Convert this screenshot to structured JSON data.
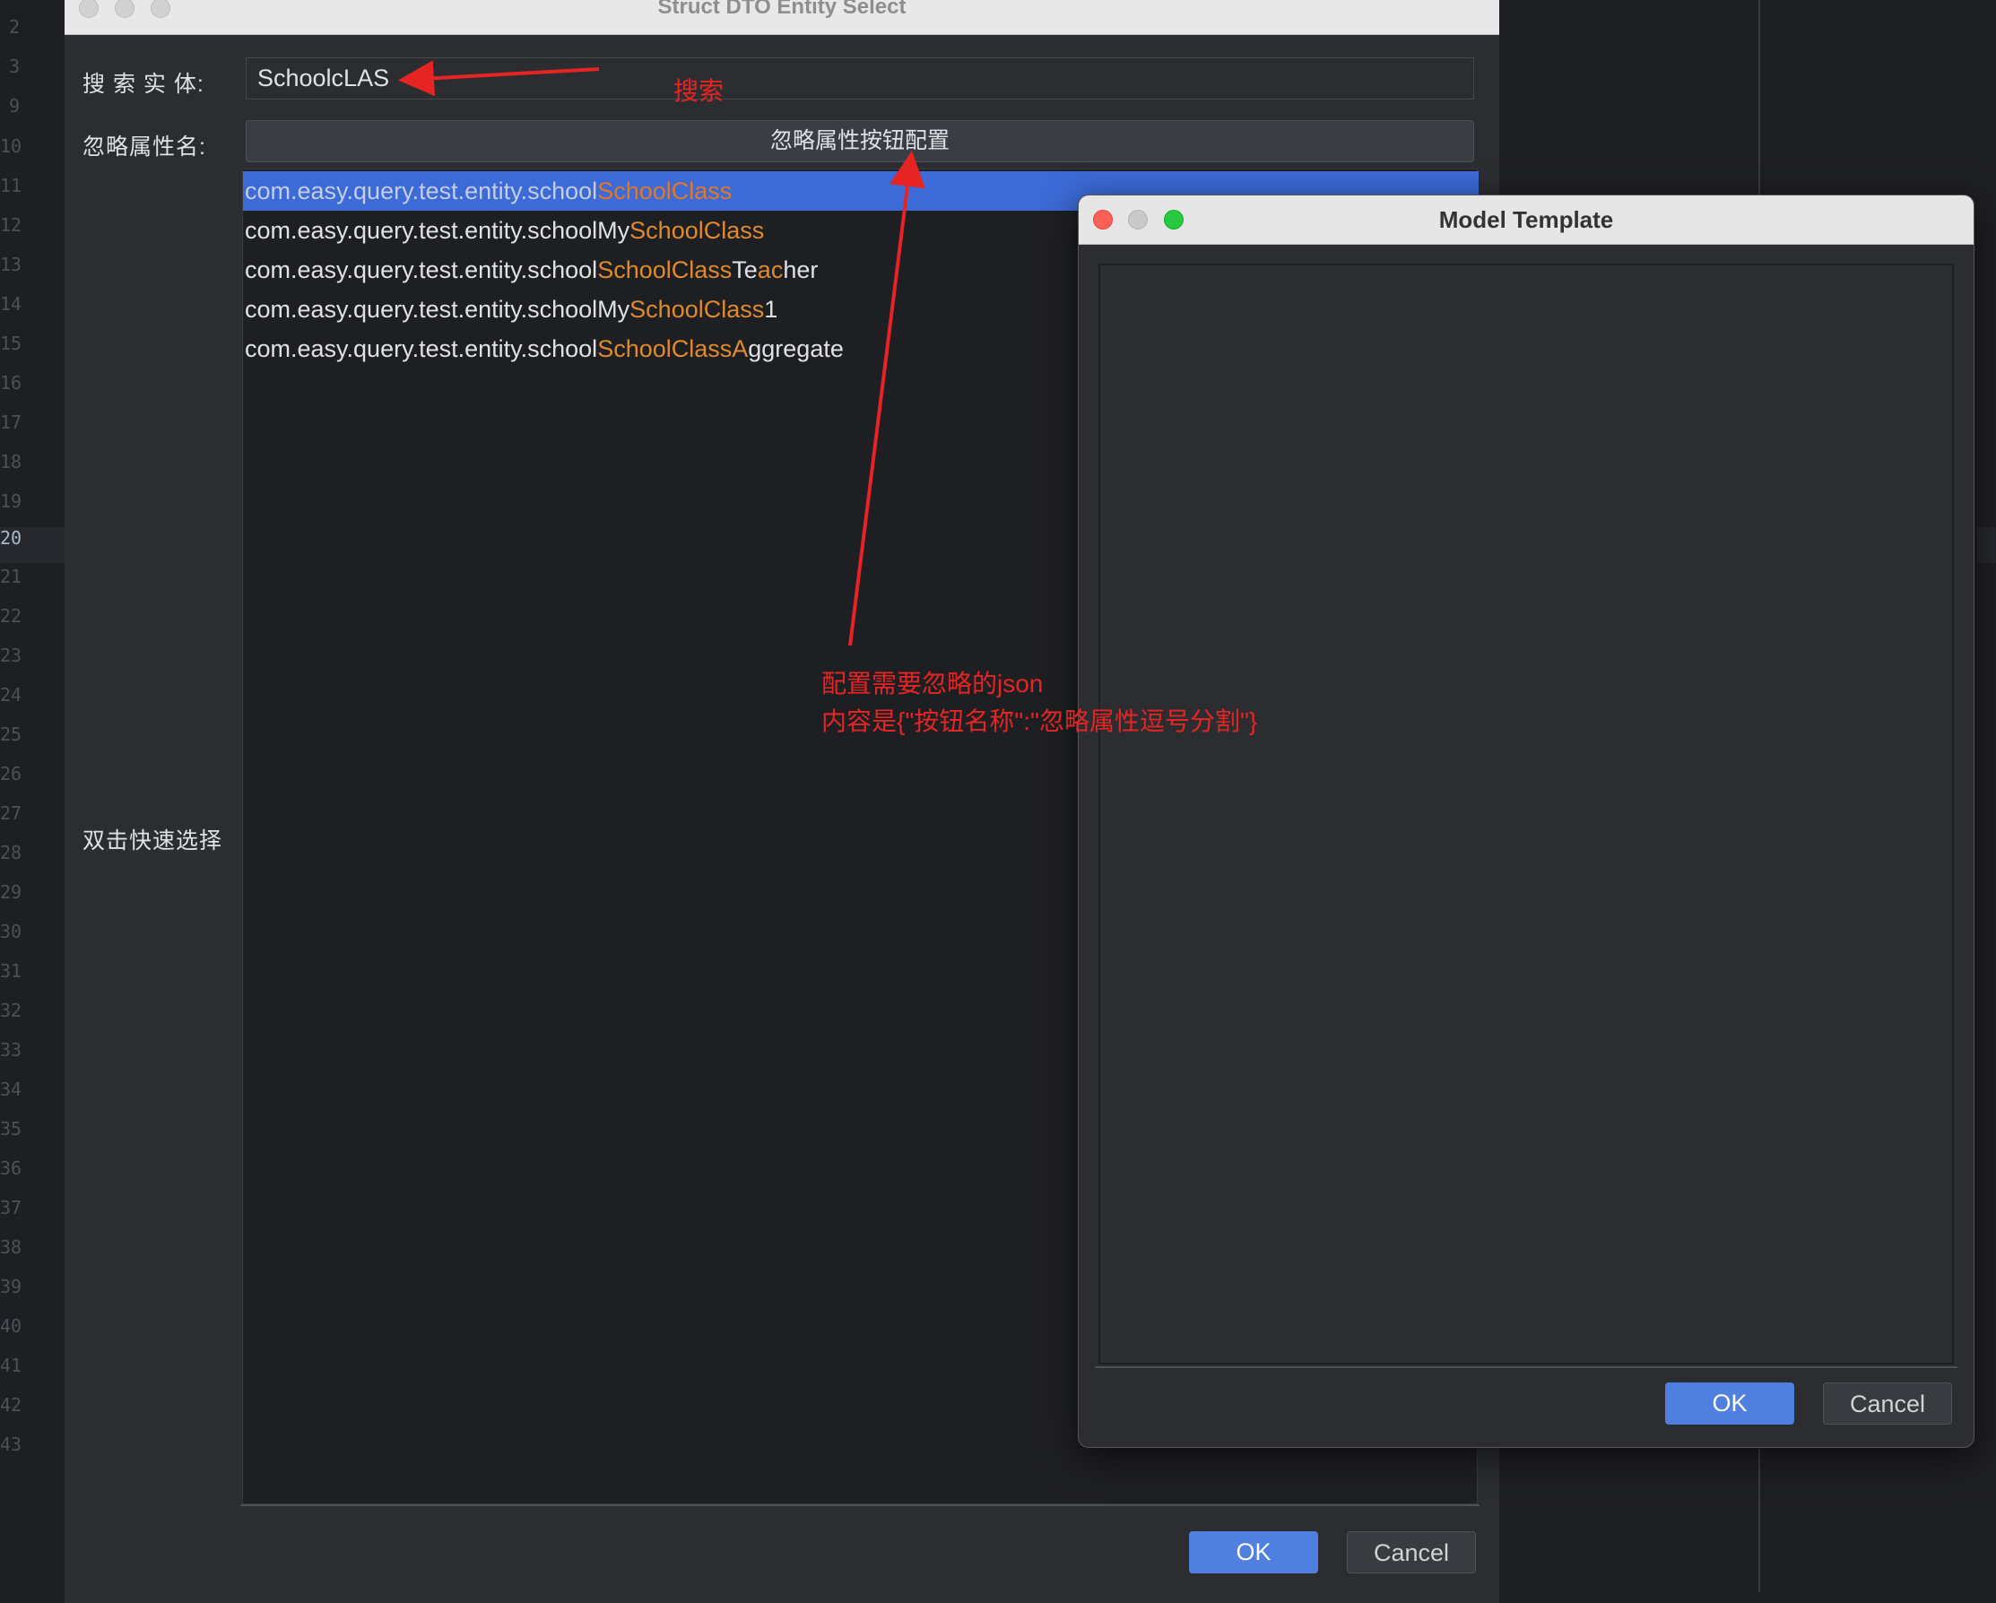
{
  "editor": {
    "line_numbers": [
      "2",
      "3",
      "9",
      "10",
      "11",
      "12",
      "13",
      "14",
      "15",
      "16",
      "17",
      "18",
      "19",
      "20",
      "21",
      "22",
      "23",
      "24",
      "25",
      "26",
      "27",
      "28",
      "29",
      "30",
      "31",
      "32",
      "33",
      "34",
      "35",
      "36",
      "37",
      "38",
      "39",
      "40",
      "41",
      "42",
      "43"
    ]
  },
  "main_dialog": {
    "title": "Struct DTO Entity Select",
    "search_label": "搜 索 实 体:",
    "search_value": "SchoolcLAS",
    "ignore_label": "忽略属性名:",
    "ignore_button": "忽略属性按钮配置",
    "list_label": "双击快速选择",
    "entities": [
      {
        "prefix": "com.easy.query.test.entity.school",
        "parts": [
          {
            "t": "SchoolClass",
            "h": true
          }
        ],
        "selected": true
      },
      {
        "prefix": "com.easy.query.test.entity.schoolMy",
        "parts": [
          {
            "t": "SchoolClass",
            "h": true
          }
        ],
        "selected": false
      },
      {
        "prefix": "com.easy.query.test.entity.school",
        "parts": [
          {
            "t": "SchoolClass",
            "h": true
          },
          {
            "t": "Te",
            "h": false
          },
          {
            "t": "ac",
            "h": true
          },
          {
            "t": "her",
            "h": false
          }
        ],
        "selected": false
      },
      {
        "prefix": "com.easy.query.test.entity.schoolMy",
        "parts": [
          {
            "t": "SchoolClass",
            "h": true
          },
          {
            "t": "1",
            "h": false
          }
        ],
        "selected": false
      },
      {
        "prefix": "com.easy.query.test.entity.school",
        "parts": [
          {
            "t": "SchoolClassA",
            "h": true
          },
          {
            "t": "ggregate",
            "h": false
          }
        ],
        "selected": false
      }
    ],
    "ok_label": "OK",
    "cancel_label": "Cancel"
  },
  "template_dialog": {
    "title": "Model Template",
    "textarea_value": "",
    "ok_label": "OK",
    "cancel_label": "Cancel"
  },
  "annotations": {
    "search_note": "搜索",
    "config_note_line1": "配置需要忽略的json",
    "config_note_line2": "内容是{\"按钮名称\":\"忽略属性逗号分割\"}",
    "color": "#e62424"
  }
}
